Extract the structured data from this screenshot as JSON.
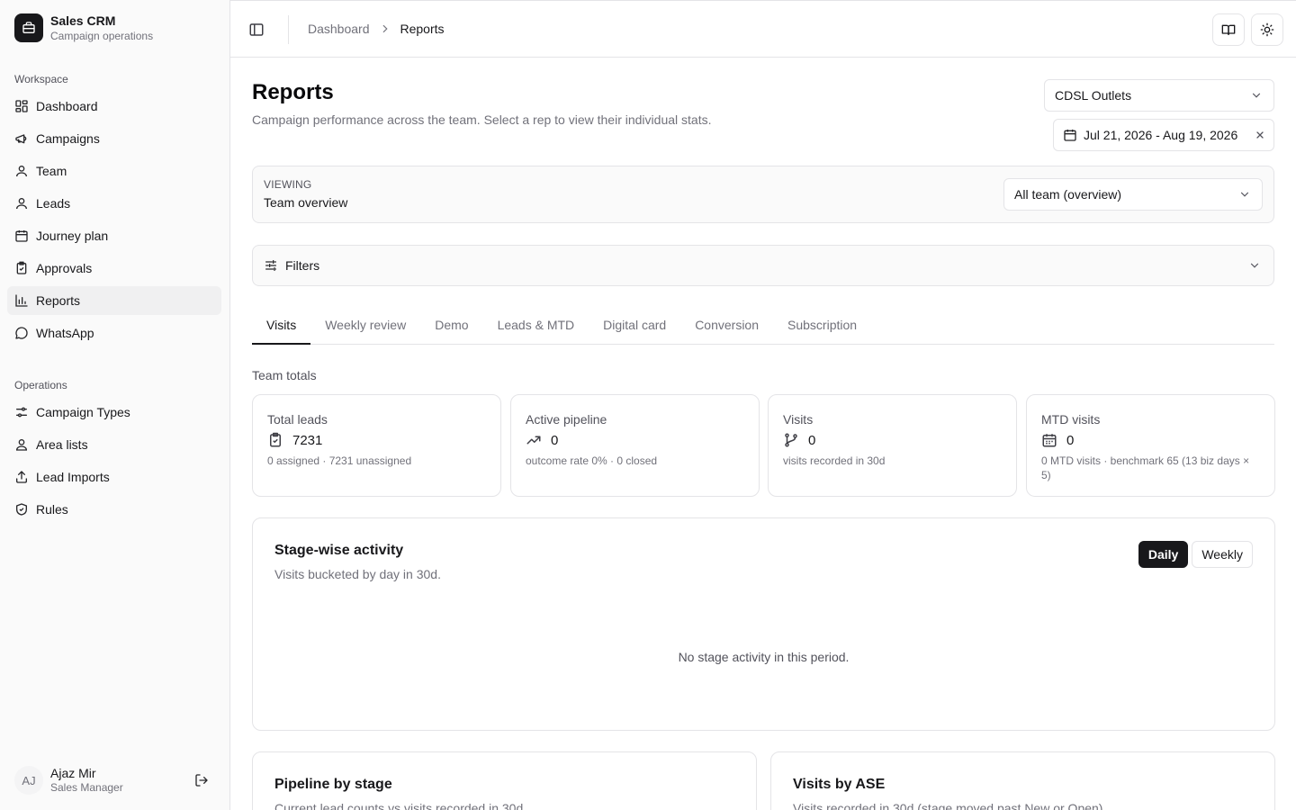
{
  "app": {
    "name": "Sales CRM",
    "subtitle": "Campaign operations"
  },
  "sidebar": {
    "groups": [
      {
        "label": "Workspace",
        "items": [
          {
            "label": "Dashboard",
            "icon": "dashboard-icon"
          },
          {
            "label": "Campaigns",
            "icon": "megaphone-icon"
          },
          {
            "label": "Team",
            "icon": "user-icon"
          },
          {
            "label": "Leads",
            "icon": "user-icon"
          },
          {
            "label": "Journey plan",
            "icon": "calendar-icon"
          },
          {
            "label": "Approvals",
            "icon": "clipboard-check-icon"
          },
          {
            "label": "Reports",
            "icon": "bar-chart-icon",
            "active": true
          },
          {
            "label": "WhatsApp",
            "icon": "message-circle-icon"
          }
        ]
      },
      {
        "label": "Operations",
        "items": [
          {
            "label": "Campaign Types",
            "icon": "sliders-icon"
          },
          {
            "label": "Area lists",
            "icon": "contacts-icon"
          },
          {
            "label": "Lead Imports",
            "icon": "upload-icon"
          },
          {
            "label": "Rules",
            "icon": "shield-check-icon"
          }
        ]
      }
    ],
    "user": {
      "initials": "AJ",
      "name": "Ajaz Mir",
      "role": "Sales Manager"
    }
  },
  "header": {
    "breadcrumb": [
      "Dashboard",
      "Reports"
    ]
  },
  "page": {
    "title": "Reports",
    "subtitle": "Campaign performance across the team. Select a rep to view their individual stats.",
    "outlet_select": "CDSL Outlets",
    "date_range": "Jul 21, 2026 - Aug 19, 2026",
    "viewing": {
      "label": "VIEWING",
      "value": "Team overview",
      "select": "All team (overview)"
    },
    "filters_label": "Filters",
    "tabs": [
      "Visits",
      "Weekly review",
      "Demo",
      "Leads & MTD",
      "Digital card",
      "Conversion",
      "Subscription"
    ],
    "active_tab": "Visits",
    "section_label": "Team totals",
    "cards": [
      {
        "title": "Total leads",
        "value": "7231",
        "note": "0 assigned · 7231 unassigned",
        "icon": "clipboard-check-icon"
      },
      {
        "title": "Active pipeline",
        "value": "0",
        "note": "outcome rate 0% · 0 closed",
        "icon": "trending-up-icon"
      },
      {
        "title": "Visits",
        "value": "0",
        "note": "visits recorded in 30d",
        "icon": "git-branch-icon"
      },
      {
        "title": "MTD visits",
        "value": "0",
        "note": "0 MTD visits · benchmark 65 (13 biz days × 5)",
        "icon": "calendar-icon"
      }
    ],
    "stage_activity": {
      "title": "Stage-wise activity",
      "subtitle": "Visits bucketed by day in 30d.",
      "toggle": [
        "Daily",
        "Weekly"
      ],
      "active_toggle": "Daily",
      "empty": "No stage activity in this period."
    },
    "pipeline": {
      "title": "Pipeline by stage",
      "subtitle": "Current lead counts vs visits recorded in 30d"
    },
    "visits_by_ase": {
      "title": "Visits by ASE",
      "subtitle": "Visits recorded in 30d (stage moved past New or Open)"
    }
  }
}
